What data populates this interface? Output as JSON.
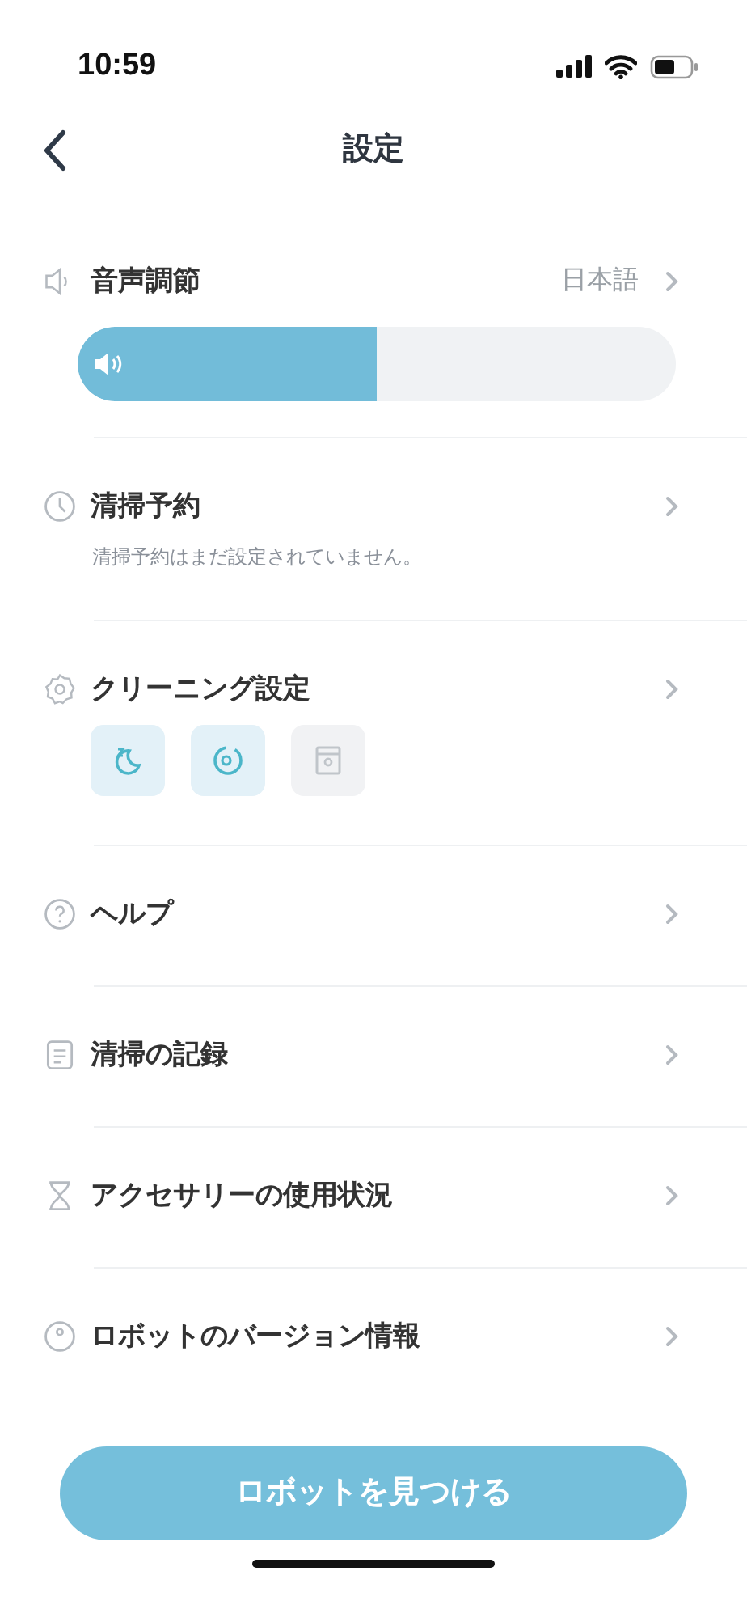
{
  "status_bar": {
    "time": "10:59"
  },
  "header": {
    "title": "設定"
  },
  "items": [
    {
      "kind": "volume",
      "label": "音声調節",
      "value": "日本語",
      "level": 0.5
    },
    {
      "kind": "schedule",
      "label": "清掃予約",
      "note": "清掃予約はまだ設定されていません。"
    },
    {
      "kind": "modes",
      "label": "クリーニング設定",
      "modes": [
        {
          "on": true
        },
        {
          "on": true
        },
        {
          "on": false
        }
      ]
    },
    {
      "kind": "link",
      "label": "ヘルプ"
    },
    {
      "kind": "link",
      "label": "清掃の記録"
    },
    {
      "kind": "link",
      "label": "アクセサリーの使用状況"
    },
    {
      "kind": "link",
      "label": "ロボットのバージョン情報"
    }
  ],
  "action_button": {
    "label": "ロボットを見つける"
  }
}
